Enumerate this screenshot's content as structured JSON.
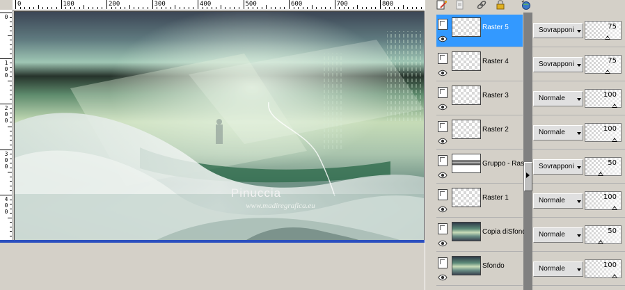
{
  "rulers": {
    "top_labels": [
      "0",
      "100",
      "200",
      "300",
      "400",
      "500",
      "600",
      "700",
      "800"
    ],
    "left_labels": [
      "0",
      "100",
      "200",
      "300",
      "400"
    ]
  },
  "image": {
    "watermark_name": "Pinuccia",
    "watermark_url": "www.madiregrafica.eu"
  },
  "colors": {
    "selection_blue": "#3399ff",
    "canvas_scroll_blue": "#2b4fbf",
    "panel_gray": "#d4d0c8"
  },
  "toolbar": {
    "icons": [
      "paint-layer-icon",
      "new-layer-icon",
      "link-icon",
      "lock-icon",
      "globe-icon"
    ]
  },
  "layers": [
    {
      "name": "Raster 5",
      "blend": "Sovrapponi",
      "opacity": "75",
      "opacity_fraction": 0.75,
      "thumb": "transparent",
      "selected": true
    },
    {
      "name": "Raster 4",
      "blend": "Sovrapponi",
      "opacity": "75",
      "opacity_fraction": 0.75,
      "thumb": "transparent",
      "selected": false
    },
    {
      "name": "Raster 3",
      "blend": "Normale",
      "opacity": "100",
      "opacity_fraction": 1.0,
      "thumb": "transparent",
      "selected": false
    },
    {
      "name": "Raster 2",
      "blend": "Normale",
      "opacity": "100",
      "opacity_fraction": 1.0,
      "thumb": "transparent",
      "selected": false
    },
    {
      "name": "Gruppo - Raste",
      "blend": "Sovrapponi",
      "opacity": "50",
      "opacity_fraction": 0.5,
      "thumb": "gruppo",
      "selected": false
    },
    {
      "name": "Raster 1",
      "blend": "Normale",
      "opacity": "100",
      "opacity_fraction": 1.0,
      "thumb": "transparent",
      "selected": false
    },
    {
      "name": "Copia diSfondo",
      "blend": "Normale",
      "opacity": "50",
      "opacity_fraction": 0.5,
      "thumb": "photo",
      "selected": false
    },
    {
      "name": "Sfondo",
      "blend": "Normale",
      "opacity": "100",
      "opacity_fraction": 1.0,
      "thumb": "photo",
      "selected": false
    }
  ]
}
